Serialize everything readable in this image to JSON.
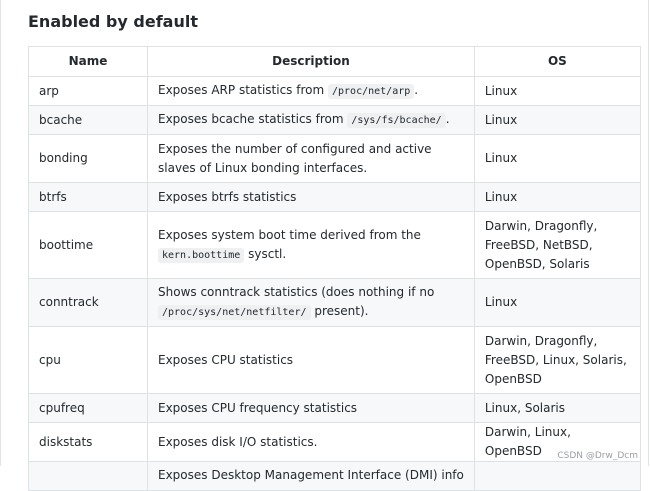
{
  "heading": "Enabled by default",
  "table": {
    "headers": [
      "Name",
      "Description",
      "OS"
    ],
    "rows": [
      {
        "name": "arp",
        "desc_pre": "Exposes ARP statistics from",
        "desc_code": "/proc/net/arp",
        "desc_post": ".",
        "os": "Linux"
      },
      {
        "name": "bcache",
        "desc_pre": "Exposes bcache statistics from",
        "desc_code": "/sys/fs/bcache/",
        "desc_post": ".",
        "os": "Linux"
      },
      {
        "name": "bonding",
        "desc_pre": "Exposes the number of configured and active slaves of Linux bonding interfaces.",
        "desc_code": "",
        "desc_post": "",
        "os": "Linux"
      },
      {
        "name": "btrfs",
        "desc_pre": "Exposes btrfs statistics",
        "desc_code": "",
        "desc_post": "",
        "os": "Linux"
      },
      {
        "name": "boottime",
        "desc_pre": "Exposes system boot time derived from the",
        "desc_code": "kern.boottime",
        "desc_post": "sysctl.",
        "os": "Darwin, Dragonfly, FreeBSD, NetBSD, OpenBSD, Solaris"
      },
      {
        "name": "conntrack",
        "desc_pre": "Shows conntrack statistics (does nothing if no",
        "desc_code": "/proc/sys/net/netfilter/",
        "desc_post": "present).",
        "os": "Linux"
      },
      {
        "name": "cpu",
        "desc_pre": "Exposes CPU statistics",
        "desc_code": "",
        "desc_post": "",
        "os": "Darwin, Dragonfly, FreeBSD, Linux, Solaris, OpenBSD"
      },
      {
        "name": "cpufreq",
        "desc_pre": "Exposes CPU frequency statistics",
        "desc_code": "",
        "desc_post": "",
        "os": "Linux, Solaris"
      },
      {
        "name": "diskstats",
        "desc_pre": "Exposes disk I/O statistics.",
        "desc_code": "",
        "desc_post": "",
        "os": "Darwin, Linux, OpenBSD"
      },
      {
        "name": "",
        "desc_pre": "Exposes Desktop Management Interface (DMI) info",
        "desc_code": "",
        "desc_post": "",
        "os": ""
      }
    ]
  },
  "watermark": "CSDN @Drw_Dcm"
}
